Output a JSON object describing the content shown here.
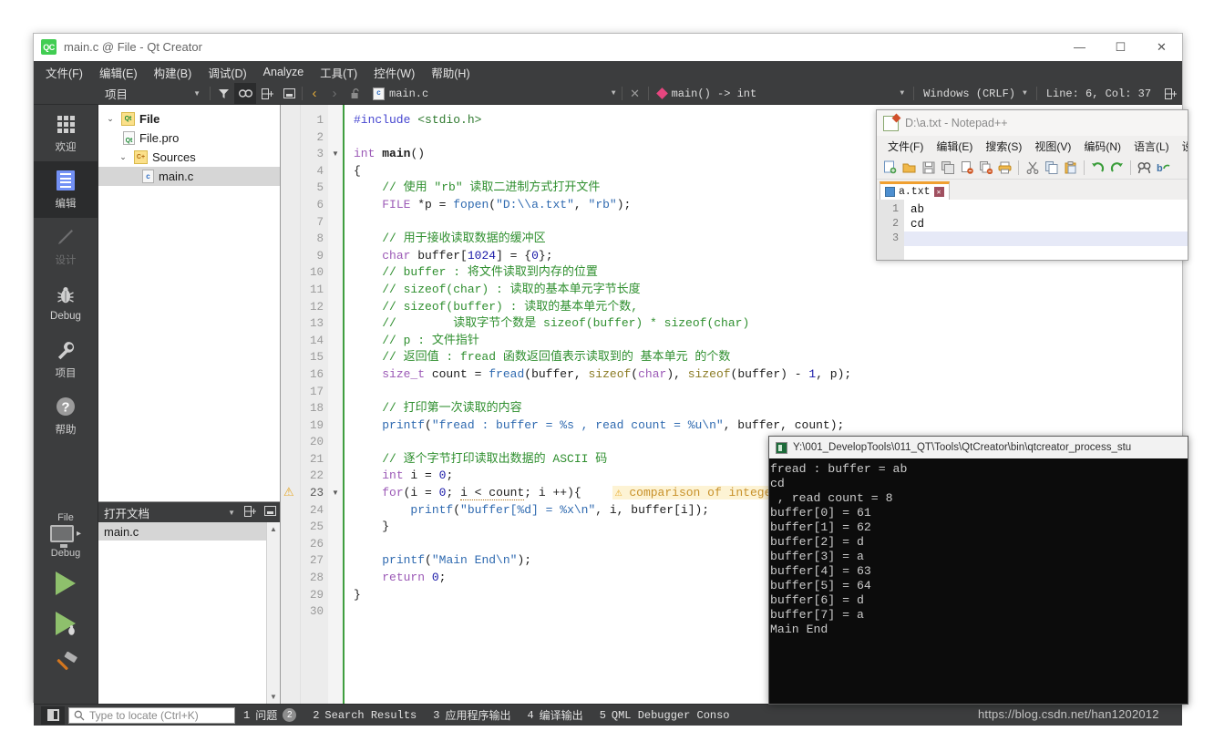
{
  "qt_window": {
    "title": "main.c @ File - Qt Creator",
    "logo_text": "QC",
    "window_controls": {
      "minimize": "—",
      "maximize": "☐",
      "close": "✕"
    },
    "menus": [
      {
        "label": "文件(F)"
      },
      {
        "label": "编辑(E)"
      },
      {
        "label": "构建(B)"
      },
      {
        "label": "调试(D)"
      },
      {
        "label": "Analyze"
      },
      {
        "label": "工具(T)"
      },
      {
        "label": "控件(W)"
      },
      {
        "label": "帮助(H)"
      }
    ],
    "toolbar": {
      "project_combo": "项目",
      "combo_arrow": "▼",
      "filter_icon": "filter-icon",
      "link_icon": "link-icon",
      "split_add_icon": "add-split-icon",
      "collapse_icon": "collapse-icon",
      "nav_back": "‹",
      "nav_forward": "›",
      "lock_icon": "unlock-icon",
      "file_name": "main.c",
      "close_doc": "✕",
      "symbol": "main() -> int",
      "line_ending": "Windows (CRLF)",
      "line_col": "Line: 6, Col: 37",
      "split_icon": "split-editor-icon"
    },
    "modes": [
      {
        "label": "欢迎",
        "icon": "grid-icon",
        "state": "normal"
      },
      {
        "label": "编辑",
        "icon": "document-lines-icon",
        "state": "selected"
      },
      {
        "label": "设计",
        "icon": "pencil-icon",
        "state": "disabled"
      },
      {
        "label": "Debug",
        "icon": "bug-icon",
        "state": "normal"
      },
      {
        "label": "项目",
        "icon": "wrench-icon",
        "state": "normal"
      },
      {
        "label": "帮助",
        "icon": "question-icon",
        "state": "normal"
      }
    ],
    "kit_selector": {
      "kit_label": "File",
      "mode_label": "Debug",
      "monitor_icon": "monitor-icon",
      "expand_arrow": "▸",
      "run_icon": "run-triangle-icon",
      "debug_icon": "debug-run-icon",
      "build_icon": "hammer-icon"
    },
    "project_panel": {
      "header": "项目",
      "header_arrow": "▼",
      "tree": [
        {
          "label": "File",
          "icon": "qt-project-icon",
          "chevron": "⌄",
          "indent": 0,
          "bold": true,
          "selected": false
        },
        {
          "label": "File.pro",
          "icon": "pro-file-icon",
          "chevron": "",
          "indent": 1,
          "bold": false,
          "selected": false
        },
        {
          "label": "Sources",
          "icon": "sources-folder-icon",
          "chevron": "⌄",
          "indent": 1,
          "bold": false,
          "selected": false
        },
        {
          "label": "main.c",
          "icon": "c-file-icon",
          "chevron": "",
          "indent": 2,
          "bold": false,
          "selected": true
        }
      ]
    },
    "open_documents": {
      "header": "打开文档",
      "header_arrow": "▼",
      "items": [
        {
          "label": "main.c"
        }
      ]
    },
    "statusbar": {
      "sidebar_toggle": "toggle-sidebar-icon",
      "locator_placeholder": "Type to locate (Ctrl+K)",
      "tabs": [
        {
          "num": "1",
          "label": "问题",
          "badge": "2"
        },
        {
          "num": "2",
          "label": "Search Results",
          "badge": ""
        },
        {
          "num": "3",
          "label": "应用程序输出",
          "badge": ""
        },
        {
          "num": "4",
          "label": "编译输出",
          "badge": ""
        },
        {
          "num": "5",
          "label": "QML Debugger Conso",
          "badge": ""
        }
      ]
    },
    "editor": {
      "warning_line": 23,
      "warning_text": "comparison of integers",
      "warning_marker": "⚠",
      "fold_lines": [
        3,
        23
      ],
      "lines": [
        {
          "n": 1,
          "tokens": [
            {
              "t": "#include ",
              "c": "c-pre"
            },
            {
              "t": "<stdio.h>",
              "c": "c-inc"
            }
          ]
        },
        {
          "n": 2,
          "tokens": []
        },
        {
          "n": 3,
          "tokens": [
            {
              "t": "int ",
              "c": "c-type"
            },
            {
              "t": "main",
              "c": "c-fn"
            },
            {
              "t": "()",
              "c": "c-plain"
            }
          ]
        },
        {
          "n": 4,
          "tokens": [
            {
              "t": "{",
              "c": "c-plain"
            }
          ]
        },
        {
          "n": 5,
          "tokens": [
            {
              "t": "    // 使用 \"rb\" 读取二进制方式打开文件",
              "c": "c-cmt"
            }
          ]
        },
        {
          "n": 6,
          "tokens": [
            {
              "t": "    ",
              "c": "c-plain"
            },
            {
              "t": "FILE",
              "c": "c-type"
            },
            {
              "t": " *p = ",
              "c": "c-plain"
            },
            {
              "t": "fopen",
              "c": "c-call"
            },
            {
              "t": "(",
              "c": "c-plain"
            },
            {
              "t": "\"D:\\\\a.txt\"",
              "c": "c-str"
            },
            {
              "t": ", ",
              "c": "c-plain"
            },
            {
              "t": "\"rb\"",
              "c": "c-str"
            },
            {
              "t": ");",
              "c": "c-plain"
            }
          ]
        },
        {
          "n": 7,
          "tokens": []
        },
        {
          "n": 8,
          "tokens": [
            {
              "t": "    // 用于接收读取数据的缓冲区",
              "c": "c-cmt"
            }
          ]
        },
        {
          "n": 9,
          "tokens": [
            {
              "t": "    ",
              "c": "c-plain"
            },
            {
              "t": "char",
              "c": "c-type"
            },
            {
              "t": " buffer[",
              "c": "c-plain"
            },
            {
              "t": "1024",
              "c": "c-num"
            },
            {
              "t": "] = {",
              "c": "c-plain"
            },
            {
              "t": "0",
              "c": "c-num"
            },
            {
              "t": "};",
              "c": "c-plain"
            }
          ]
        },
        {
          "n": 10,
          "tokens": [
            {
              "t": "    // buffer : 将文件读取到内存的位置",
              "c": "c-cmt"
            }
          ]
        },
        {
          "n": 11,
          "tokens": [
            {
              "t": "    // sizeof(char) : 读取的基本单元字节长度",
              "c": "c-cmt"
            }
          ]
        },
        {
          "n": 12,
          "tokens": [
            {
              "t": "    // sizeof(buffer) : 读取的基本单元个数,",
              "c": "c-cmt"
            }
          ]
        },
        {
          "n": 13,
          "tokens": [
            {
              "t": "    //        读取字节个数是 sizeof(buffer) * sizeof(char)",
              "c": "c-cmt"
            }
          ]
        },
        {
          "n": 14,
          "tokens": [
            {
              "t": "    // p : 文件指针",
              "c": "c-cmt"
            }
          ]
        },
        {
          "n": 15,
          "tokens": [
            {
              "t": "    // 返回值 : fread 函数返回值表示读取到的 基本单元 的个数",
              "c": "c-cmt"
            }
          ]
        },
        {
          "n": 16,
          "tokens": [
            {
              "t": "    ",
              "c": "c-plain"
            },
            {
              "t": "size_t",
              "c": "c-type"
            },
            {
              "t": " count = ",
              "c": "c-plain"
            },
            {
              "t": "fread",
              "c": "c-call"
            },
            {
              "t": "(buffer, ",
              "c": "c-plain"
            },
            {
              "t": "sizeof",
              "c": "c-field"
            },
            {
              "t": "(",
              "c": "c-plain"
            },
            {
              "t": "char",
              "c": "c-type"
            },
            {
              "t": "), ",
              "c": "c-plain"
            },
            {
              "t": "sizeof",
              "c": "c-field"
            },
            {
              "t": "(buffer) - ",
              "c": "c-plain"
            },
            {
              "t": "1",
              "c": "c-num"
            },
            {
              "t": ", p);",
              "c": "c-plain"
            }
          ]
        },
        {
          "n": 17,
          "tokens": []
        },
        {
          "n": 18,
          "tokens": [
            {
              "t": "    // 打印第一次读取的内容",
              "c": "c-cmt"
            }
          ]
        },
        {
          "n": 19,
          "tokens": [
            {
              "t": "    ",
              "c": "c-plain"
            },
            {
              "t": "printf",
              "c": "c-call"
            },
            {
              "t": "(",
              "c": "c-plain"
            },
            {
              "t": "\"fread : buffer = %s , read count = %u\\n\"",
              "c": "c-str"
            },
            {
              "t": ", buffer, count);",
              "c": "c-plain"
            }
          ]
        },
        {
          "n": 20,
          "tokens": []
        },
        {
          "n": 21,
          "tokens": [
            {
              "t": "    // 逐个字节打印读取出数据的 ASCII 码",
              "c": "c-cmt"
            }
          ]
        },
        {
          "n": 22,
          "tokens": [
            {
              "t": "    ",
              "c": "c-plain"
            },
            {
              "t": "int",
              "c": "c-type"
            },
            {
              "t": " i = ",
              "c": "c-plain"
            },
            {
              "t": "0",
              "c": "c-num"
            },
            {
              "t": ";",
              "c": "c-plain"
            }
          ]
        },
        {
          "n": 23,
          "tokens": [
            {
              "t": "    ",
              "c": "c-plain"
            },
            {
              "t": "for",
              "c": "c-kw"
            },
            {
              "t": "(i = ",
              "c": "c-plain"
            },
            {
              "t": "0",
              "c": "c-num"
            },
            {
              "t": "; ",
              "c": "c-plain"
            },
            {
              "t": "i < count",
              "c": "c-plain squig"
            },
            {
              "t": "; i ++){",
              "c": "c-plain"
            }
          ]
        },
        {
          "n": 24,
          "tokens": [
            {
              "t": "        ",
              "c": "c-plain"
            },
            {
              "t": "printf",
              "c": "c-call"
            },
            {
              "t": "(",
              "c": "c-plain"
            },
            {
              "t": "\"buffer[%d] = %x\\n\"",
              "c": "c-str"
            },
            {
              "t": ", i, buffer[i]);",
              "c": "c-plain"
            }
          ]
        },
        {
          "n": 25,
          "tokens": [
            {
              "t": "    }",
              "c": "c-plain"
            }
          ]
        },
        {
          "n": 26,
          "tokens": []
        },
        {
          "n": 27,
          "tokens": [
            {
              "t": "    ",
              "c": "c-plain"
            },
            {
              "t": "printf",
              "c": "c-call"
            },
            {
              "t": "(",
              "c": "c-plain"
            },
            {
              "t": "\"Main End\\n\"",
              "c": "c-str"
            },
            {
              "t": ");",
              "c": "c-plain"
            }
          ]
        },
        {
          "n": 28,
          "tokens": [
            {
              "t": "    ",
              "c": "c-plain"
            },
            {
              "t": "return",
              "c": "c-kw"
            },
            {
              "t": " ",
              "c": "c-plain"
            },
            {
              "t": "0",
              "c": "c-num"
            },
            {
              "t": ";",
              "c": "c-plain"
            }
          ]
        },
        {
          "n": 29,
          "tokens": [
            {
              "t": "}",
              "c": "c-plain"
            }
          ]
        },
        {
          "n": 30,
          "tokens": []
        }
      ]
    }
  },
  "notepad": {
    "title": "D:\\a.txt - Notepad++",
    "menus": [
      "文件(F)",
      "编辑(E)",
      "搜索(S)",
      "视图(V)",
      "编码(N)",
      "语言(L)",
      "设"
    ],
    "toolbar_icons": [
      "new-file-icon",
      "open-file-icon",
      "save-icon",
      "save-all-icon",
      "close-file-icon",
      "close-all-icon",
      "print-icon",
      "cut-icon",
      "copy-icon",
      "paste-icon",
      "undo-icon",
      "redo-icon",
      "find-icon",
      "replace-icon"
    ],
    "tab": {
      "label": "a.txt",
      "save_icon": "save-state-icon",
      "close_icon": "✕"
    },
    "content_lines": [
      {
        "n": 1,
        "text": "ab",
        "current": false
      },
      {
        "n": 2,
        "text": "cd",
        "current": false
      },
      {
        "n": 3,
        "text": "",
        "current": true
      }
    ]
  },
  "console": {
    "title": "Y:\\001_DevelopTools\\011_QT\\Tools\\QtCreator\\bin\\qtcreator_process_stu",
    "icon": "cmd-icon",
    "lines": [
      "fread : buffer = ab",
      "cd",
      " , read count = 8",
      "buffer[0] = 61",
      "buffer[1] = 62",
      "buffer[2] = d",
      "buffer[3] = a",
      "buffer[4] = 63",
      "buffer[5] = 64",
      "buffer[6] = d",
      "buffer[7] = a",
      "Main End"
    ]
  },
  "watermark": "https://blog.csdn.net/han1202012"
}
